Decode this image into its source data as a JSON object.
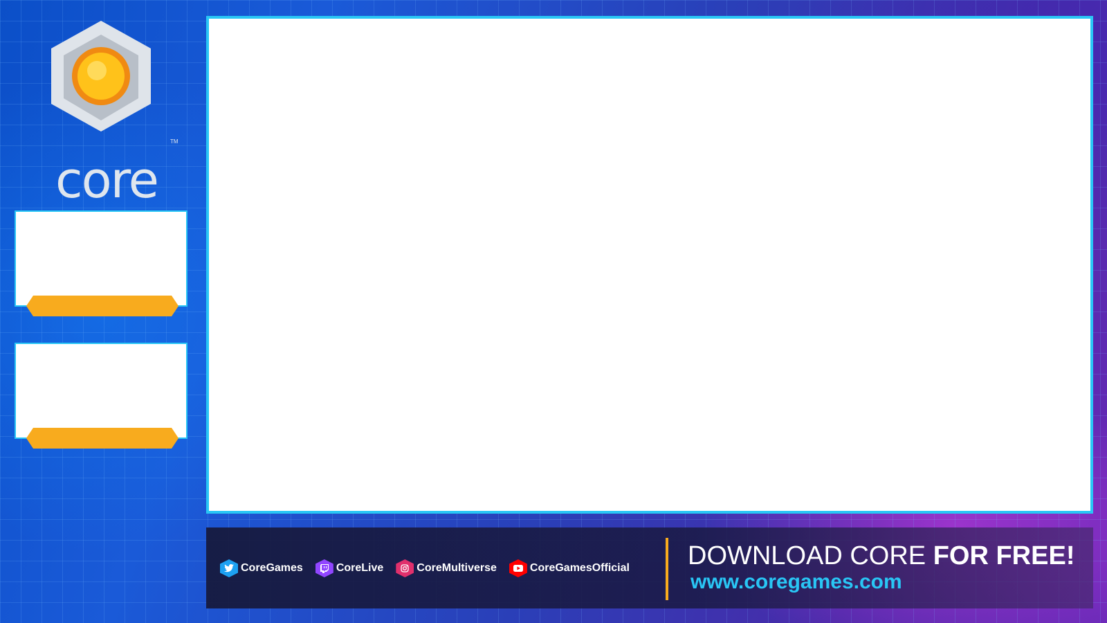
{
  "logo": {
    "word": "CORE",
    "trademark": "TM"
  },
  "socials": [
    {
      "icon": "twitter-icon",
      "label": "CoreGames",
      "color": "#1da1f2"
    },
    {
      "icon": "twitch-icon",
      "label": "CoreLive",
      "color": "#9146ff"
    },
    {
      "icon": "instagram-icon",
      "label": "CoreMultiverse",
      "color": "#e1306c"
    },
    {
      "icon": "youtube-icon",
      "label": "CoreGamesOfficial",
      "color": "#ff0000"
    }
  ],
  "cta": {
    "prefix": "DOWNLOAD CORE ",
    "emphasis": "FOR FREE!",
    "url": "www.coregames.com"
  },
  "colors": {
    "accent_cyan": "#29c6f5",
    "accent_orange": "#f8ab1e"
  }
}
